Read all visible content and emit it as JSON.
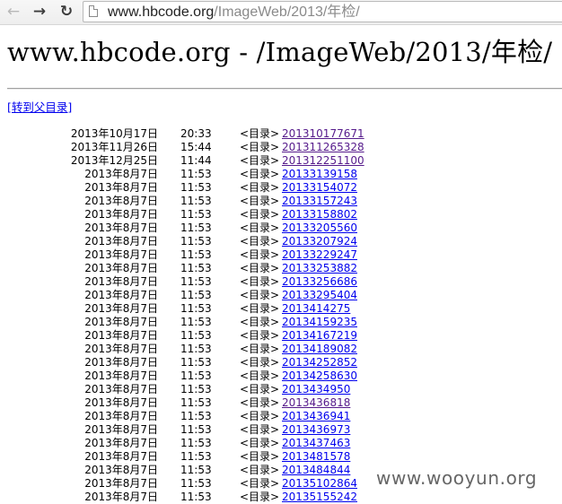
{
  "browser": {
    "url_host": "www.hbcode.org",
    "url_path": "/ImageWeb/2013/年检/"
  },
  "page": {
    "title": "www.hbcode.org - /ImageWeb/2013/年检/",
    "parent_link": "[转到父目录]"
  },
  "listing": [
    {
      "date": "2013年10月17日",
      "time": "20:33",
      "type": "<目录>",
      "name": "201310177671",
      "visited": true
    },
    {
      "date": "2013年11月26日",
      "time": "15:44",
      "type": "<目录>",
      "name": "201311265328",
      "visited": true
    },
    {
      "date": "2013年12月25日",
      "time": "11:44",
      "type": "<目录>",
      "name": "201312251100",
      "visited": true
    },
    {
      "date": "2013年8月7日",
      "time": "11:53",
      "type": "<目录>",
      "name": "20133139158",
      "visited": false
    },
    {
      "date": "2013年8月7日",
      "time": "11:53",
      "type": "<目录>",
      "name": "20133154072",
      "visited": false
    },
    {
      "date": "2013年8月7日",
      "time": "11:53",
      "type": "<目录>",
      "name": "20133157243",
      "visited": false
    },
    {
      "date": "2013年8月7日",
      "time": "11:53",
      "type": "<目录>",
      "name": "20133158802",
      "visited": false
    },
    {
      "date": "2013年8月7日",
      "time": "11:53",
      "type": "<目录>",
      "name": "20133205560",
      "visited": false
    },
    {
      "date": "2013年8月7日",
      "time": "11:53",
      "type": "<目录>",
      "name": "20133207924",
      "visited": false
    },
    {
      "date": "2013年8月7日",
      "time": "11:53",
      "type": "<目录>",
      "name": "20133229247",
      "visited": false
    },
    {
      "date": "2013年8月7日",
      "time": "11:53",
      "type": "<目录>",
      "name": "20133253882",
      "visited": false
    },
    {
      "date": "2013年8月7日",
      "time": "11:53",
      "type": "<目录>",
      "name": "20133256686",
      "visited": false
    },
    {
      "date": "2013年8月7日",
      "time": "11:53",
      "type": "<目录>",
      "name": "20133295404",
      "visited": false
    },
    {
      "date": "2013年8月7日",
      "time": "11:53",
      "type": "<目录>",
      "name": "2013414275",
      "visited": false
    },
    {
      "date": "2013年8月7日",
      "time": "11:53",
      "type": "<目录>",
      "name": "20134159235",
      "visited": false
    },
    {
      "date": "2013年8月7日",
      "time": "11:53",
      "type": "<目录>",
      "name": "20134167219",
      "visited": false
    },
    {
      "date": "2013年8月7日",
      "time": "11:53",
      "type": "<目录>",
      "name": "20134189082",
      "visited": false
    },
    {
      "date": "2013年8月7日",
      "time": "11:53",
      "type": "<目录>",
      "name": "20134252852",
      "visited": false
    },
    {
      "date": "2013年8月7日",
      "time": "11:53",
      "type": "<目录>",
      "name": "20134258630",
      "visited": false
    },
    {
      "date": "2013年8月7日",
      "time": "11:53",
      "type": "<目录>",
      "name": "2013434950",
      "visited": false
    },
    {
      "date": "2013年8月7日",
      "time": "11:53",
      "type": "<目录>",
      "name": "2013436818",
      "visited": true
    },
    {
      "date": "2013年8月7日",
      "time": "11:53",
      "type": "<目录>",
      "name": "2013436941",
      "visited": false
    },
    {
      "date": "2013年8月7日",
      "time": "11:53",
      "type": "<目录>",
      "name": "2013436973",
      "visited": false
    },
    {
      "date": "2013年8月7日",
      "time": "11:53",
      "type": "<目录>",
      "name": "2013437463",
      "visited": false
    },
    {
      "date": "2013年8月7日",
      "time": "11:53",
      "type": "<目录>",
      "name": "2013481578",
      "visited": false
    },
    {
      "date": "2013年8月7日",
      "time": "11:53",
      "type": "<目录>",
      "name": "2013484844",
      "visited": false
    },
    {
      "date": "2013年8月7日",
      "time": "11:53",
      "type": "<目录>",
      "name": "20135102864",
      "visited": false
    },
    {
      "date": "2013年8月7日",
      "time": "11:53",
      "type": "<目录>",
      "name": "20135155242",
      "visited": false
    }
  ],
  "watermark": "www.wooyun.org",
  "icons": {
    "back": "back-arrow-icon",
    "forward": "forward-arrow-icon",
    "reload": "reload-icon",
    "page": "page-icon"
  },
  "colors": {
    "link": "#0000ee",
    "visited_link": "#551a8b",
    "watermark": "#666666"
  }
}
